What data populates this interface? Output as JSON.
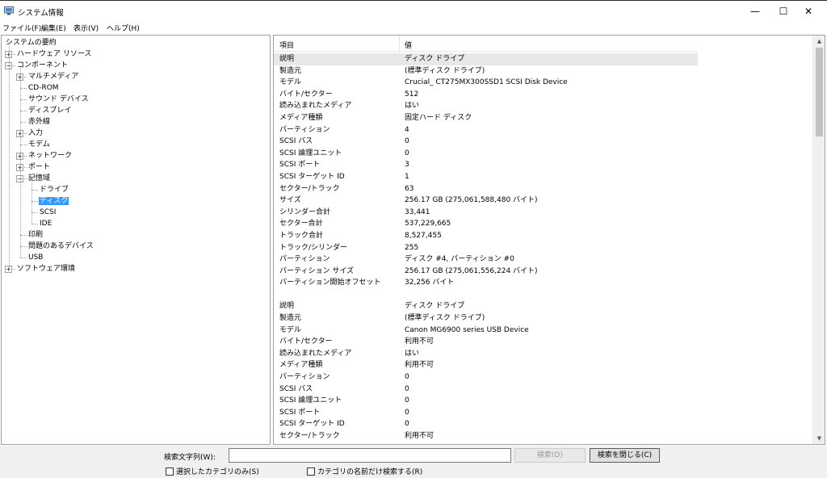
{
  "window": {
    "title": "システム情報",
    "icon": "system-info-icon",
    "controls": [
      "minimize-icon",
      "maximize-icon",
      "close-icon"
    ]
  },
  "menu": [
    {
      "label": "ファイル(F)"
    },
    {
      "label": "編集(E)"
    },
    {
      "label": "表示(V)"
    },
    {
      "label": "ヘルプ(H)"
    }
  ],
  "tree": {
    "items": [
      {
        "label": "システムの要約",
        "depth": 0,
        "toggle": ""
      },
      {
        "label": "ハードウェア リソース",
        "depth": 1,
        "toggle": "+"
      },
      {
        "label": "コンポーネント",
        "depth": 1,
        "toggle": "-"
      },
      {
        "label": "マルチメディア",
        "depth": 2,
        "toggle": "+"
      },
      {
        "label": "CD-ROM",
        "depth": 2,
        "toggle": ""
      },
      {
        "label": "サウンド デバイス",
        "depth": 2,
        "toggle": ""
      },
      {
        "label": "ディスプレイ",
        "depth": 2,
        "toggle": ""
      },
      {
        "label": "赤外線",
        "depth": 2,
        "toggle": ""
      },
      {
        "label": "入力",
        "depth": 2,
        "toggle": "+"
      },
      {
        "label": "モデム",
        "depth": 2,
        "toggle": ""
      },
      {
        "label": "ネットワーク",
        "depth": 2,
        "toggle": "+"
      },
      {
        "label": "ポート",
        "depth": 2,
        "toggle": "+"
      },
      {
        "label": "記憶域",
        "depth": 2,
        "toggle": "-"
      },
      {
        "label": "ドライブ",
        "depth": 3,
        "toggle": ""
      },
      {
        "label": "ディスク",
        "depth": 3,
        "toggle": "",
        "selected": true
      },
      {
        "label": "SCSI",
        "depth": 3,
        "toggle": ""
      },
      {
        "label": "IDE",
        "depth": 3,
        "toggle": ""
      },
      {
        "label": "印刷",
        "depth": 2,
        "toggle": ""
      },
      {
        "label": "問題のあるデバイス",
        "depth": 2,
        "toggle": ""
      },
      {
        "label": "USB",
        "depth": 2,
        "toggle": ""
      },
      {
        "label": "ソフトウェア環境",
        "depth": 1,
        "toggle": "+"
      }
    ]
  },
  "details": {
    "headers": {
      "item": "項目",
      "value": "値"
    },
    "rows": [
      {
        "k": "説明",
        "v": "ディスク ドライブ",
        "hl": true
      },
      {
        "k": "製造元",
        "v": "(標準ディスク ドライブ)"
      },
      {
        "k": "モデル",
        "v": "Crucial_ CT275MX300SSD1 SCSI Disk Device"
      },
      {
        "k": "バイト/セクター",
        "v": "512"
      },
      {
        "k": "読み込まれたメディア",
        "v": "はい"
      },
      {
        "k": "メディア種類",
        "v": "固定ハード ディスク"
      },
      {
        "k": "パーティション",
        "v": "4"
      },
      {
        "k": "SCSI バス",
        "v": "0"
      },
      {
        "k": "SCSI 論理ユニット",
        "v": "0"
      },
      {
        "k": "SCSI ポート",
        "v": "3"
      },
      {
        "k": "SCSI ターゲット ID",
        "v": "1"
      },
      {
        "k": "セクター/トラック",
        "v": "63"
      },
      {
        "k": "サイズ",
        "v": "256.17 GB (275,061,588,480 バイト)"
      },
      {
        "k": "シリンダー合計",
        "v": "33,441"
      },
      {
        "k": "セクター合計",
        "v": "537,229,665"
      },
      {
        "k": "トラック合計",
        "v": "8,527,455"
      },
      {
        "k": "トラック/シリンダー",
        "v": "255"
      },
      {
        "k": "パーティション",
        "v": "ディスク #4, パーティション #0"
      },
      {
        "k": "パーティション サイズ",
        "v": "256.17 GB (275,061,556,224 バイト)"
      },
      {
        "k": "パーティション開始オフセット",
        "v": "32,256 バイト"
      },
      {
        "k": "",
        "v": "",
        "blank": true
      },
      {
        "k": "説明",
        "v": "ディスク ドライブ"
      },
      {
        "k": "製造元",
        "v": "(標準ディスク ドライブ)"
      },
      {
        "k": "モデル",
        "v": "Canon MG6900 series USB Device"
      },
      {
        "k": "バイト/セクター",
        "v": "利用不可"
      },
      {
        "k": "読み込まれたメディア",
        "v": "はい"
      },
      {
        "k": "メディア種類",
        "v": "利用不可"
      },
      {
        "k": "パーティション",
        "v": "0"
      },
      {
        "k": "SCSI バス",
        "v": "0"
      },
      {
        "k": "SCSI 論理ユニット",
        "v": "0"
      },
      {
        "k": "SCSI ポート",
        "v": "0"
      },
      {
        "k": "SCSI ターゲット ID",
        "v": "0"
      },
      {
        "k": "セクター/トラック",
        "v": "利用不可"
      }
    ]
  },
  "search": {
    "label": "検索文字列(W):",
    "value": "",
    "find_label": "検索(D)",
    "close_label": "検索を閉じる(C)",
    "option_selected_only": "選択したカテゴリのみ(S)",
    "option_names_only": "カテゴリの名前だけ検索する(R)"
  }
}
